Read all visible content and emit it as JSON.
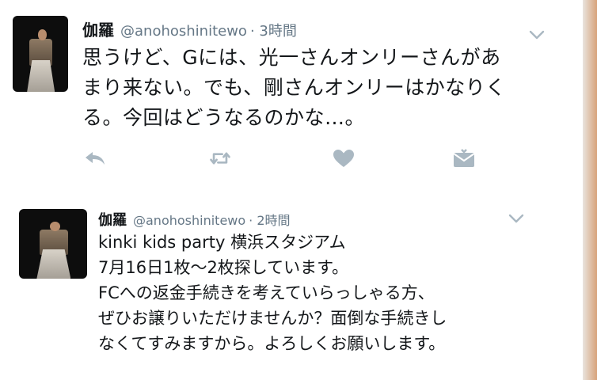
{
  "colors": {
    "text": "#14171a",
    "secondary": "#657786",
    "action_icon": "#aab8c2"
  },
  "tweets": [
    {
      "author_name": "伽羅",
      "handle": "@anohoshinitewo",
      "time": "· 3時間",
      "text": "思うけど、Gには、光一さんオンリーさんがあ\nまり来ない。でも、剛さんオンリーはかなりく\nる。今回はどうなるのかな…。"
    },
    {
      "author_name": "伽羅",
      "handle": "@anohoshinitewo",
      "time": "· 2時間",
      "text": "kinki kids party 横浜スタジアム\n7月16日1枚〜2枚探しています。\nFCへの返金手続きを考えていらっしゃる方、\nぜひお譲りいただけませんか？面倒な手続きし\nなくてすみますから。よろしくお願いします。"
    }
  ],
  "icons": {
    "avatar": "person-photo",
    "more": "chevron-down-icon",
    "reply": "reply-icon",
    "retweet": "retweet-icon",
    "like": "heart-icon",
    "dm": "envelope-icon"
  }
}
